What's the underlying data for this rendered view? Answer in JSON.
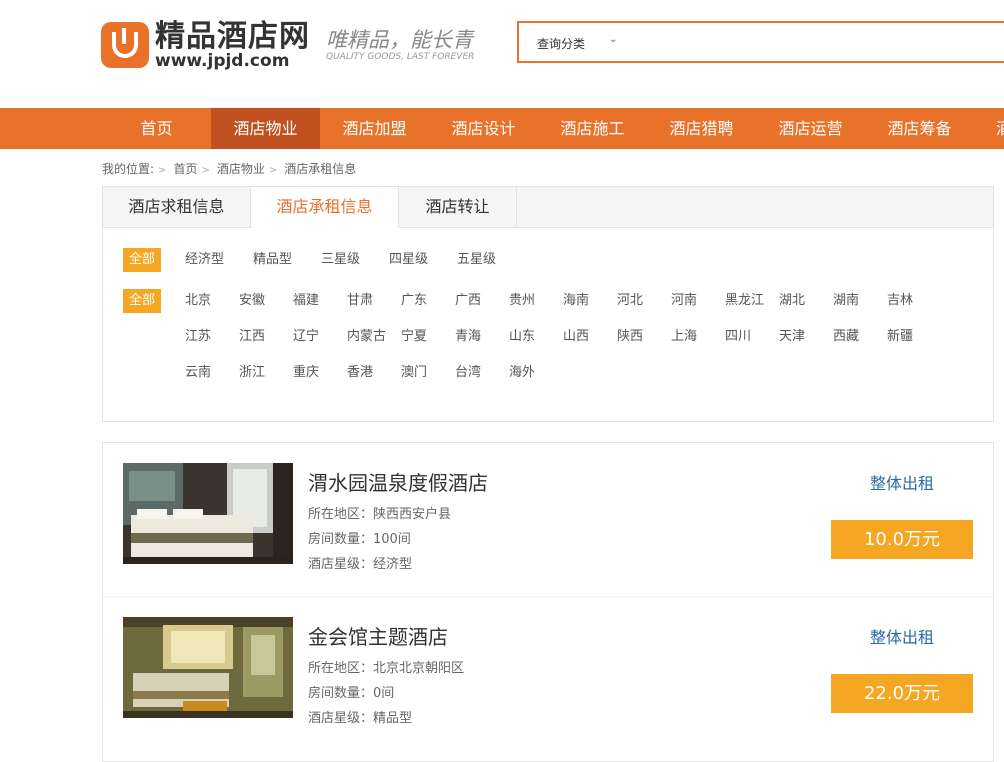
{
  "brand": {
    "name": "精品酒店网",
    "url": "www.jpjd.com",
    "slogan": "唯精品，能长青",
    "slogan_en": "QUALITY GOODS, LAST FOREVER"
  },
  "search": {
    "category": "查询分类",
    "placeholder": ""
  },
  "nav": [
    "首页",
    "酒店物业",
    "酒店加盟",
    "酒店设计",
    "酒店施工",
    "酒店猎聘",
    "酒店运营",
    "酒店筹备",
    "酒"
  ],
  "breadcrumb": [
    "我的位置:",
    "首页",
    "酒店物业",
    "酒店承租信息"
  ],
  "tabs": [
    "酒店求租信息",
    "酒店承租信息",
    "酒店转让"
  ],
  "filters": {
    "types": [
      "全部",
      "经济型",
      "精品型",
      "三星级",
      "四星级",
      "五星级"
    ],
    "regions_all": "全部",
    "regions": [
      [
        "北京",
        "安徽",
        "福建",
        "甘肃",
        "广东",
        "广西",
        "贵州",
        "海南",
        "河北",
        "河南",
        "黑龙江",
        "湖北",
        "湖南",
        "吉林"
      ],
      [
        "江苏",
        "江西",
        "辽宁",
        "内蒙古",
        "宁夏",
        "青海",
        "山东",
        "山西",
        "陕西",
        "上海",
        "四川",
        "天津",
        "西藏",
        "新疆"
      ],
      [
        "云南",
        "浙江",
        "重庆",
        "香港",
        "澳门",
        "台湾",
        "海外"
      ]
    ]
  },
  "listings": [
    {
      "title": "渭水园温泉度假酒店",
      "region": "所在地区：陕西西安户县",
      "rooms": "房间数量：100间",
      "level": "酒店星级：经济型",
      "type": "整体出租",
      "price": "10.0万元"
    },
    {
      "title": "金会馆主题酒店",
      "region": "所在地区：北京北京朝阳区",
      "rooms": "房间数量：0间",
      "level": "酒店星级：精品型",
      "type": "整体出租",
      "price": "22.0万元"
    }
  ],
  "colors": {
    "accent": "#e8722a",
    "chip": "#f5a623",
    "link": "#2a6aa8"
  },
  "icons": {
    "logo": "jp-logo-icon",
    "caret": "chevron-down-icon",
    "crumb_sep": "chevron-right-icon"
  }
}
